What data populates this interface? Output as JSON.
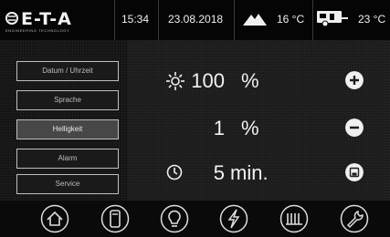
{
  "header": {
    "brand": "E-T-A",
    "brand_sub": "ENGINEERING TECHNOLOGY",
    "time": "15:34",
    "date": "23.08.2018",
    "outside_temp": "16 °C",
    "inside_temp": "23 °C"
  },
  "menu": {
    "items": [
      {
        "label": "Datum / Uhrzeit"
      },
      {
        "label": "Sprache"
      },
      {
        "label": "Helligkeit"
      },
      {
        "label": "Alarm"
      },
      {
        "label": "Service"
      }
    ]
  },
  "settings": {
    "brightness": {
      "value": "100",
      "unit": "%"
    },
    "night": {
      "value": "1",
      "unit": "%"
    },
    "timeout": {
      "value": "5",
      "unit": "min."
    }
  },
  "colors": {
    "background": "#0c0c0c",
    "panel": "#1d1d1d",
    "active_menu": "#474747",
    "text": "#f0f0f0"
  },
  "bottom_nav": [
    "home-icon",
    "phone-icon",
    "bulb-icon",
    "power-icon",
    "heater-icon",
    "wrench-icon"
  ]
}
